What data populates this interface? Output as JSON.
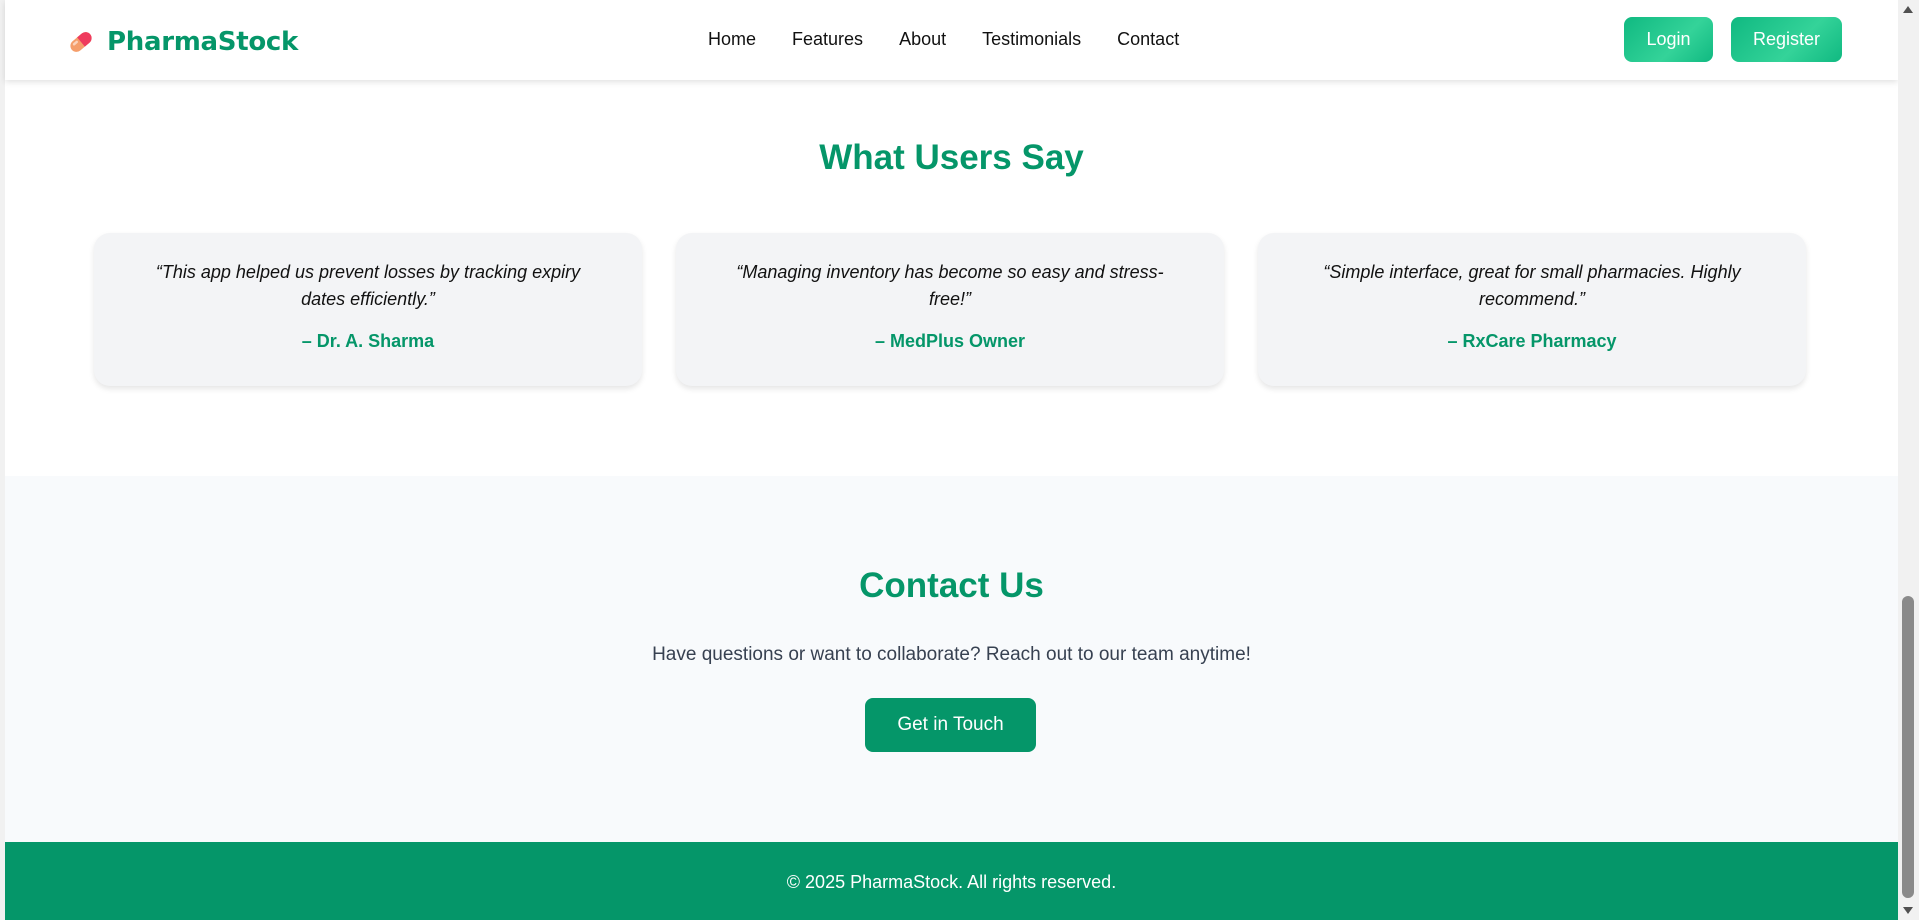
{
  "brand": {
    "name": "PharmaStock"
  },
  "nav": {
    "items": [
      "Home",
      "Features",
      "About",
      "Testimonials",
      "Contact"
    ],
    "login_label": "Login",
    "register_label": "Register"
  },
  "testimonials": {
    "title": "What Users Say",
    "cards": [
      {
        "quote": "“This app helped us prevent losses by tracking expiry dates efficiently.”",
        "author": "– Dr. A. Sharma"
      },
      {
        "quote": "“Managing inventory has become so easy and stress-free!”",
        "author": "– MedPlus Owner"
      },
      {
        "quote": "“Simple interface, great for small pharmacies. Highly recommend.”",
        "author": "– RxCare Pharmacy"
      }
    ]
  },
  "contact": {
    "title": "Contact Us",
    "text": "Have questions or want to collaborate? Reach out to our team anytime!",
    "button_label": "Get in Touch"
  },
  "footer": {
    "text": "© 2025 PharmaStock. All rights reserved."
  },
  "colors": {
    "brand_green": "#059669",
    "button_gradient": "#10b981",
    "card_bg": "#f3f4f6",
    "section_bg": "#f8fafc"
  },
  "icons": {
    "logo": "pill-icon"
  }
}
